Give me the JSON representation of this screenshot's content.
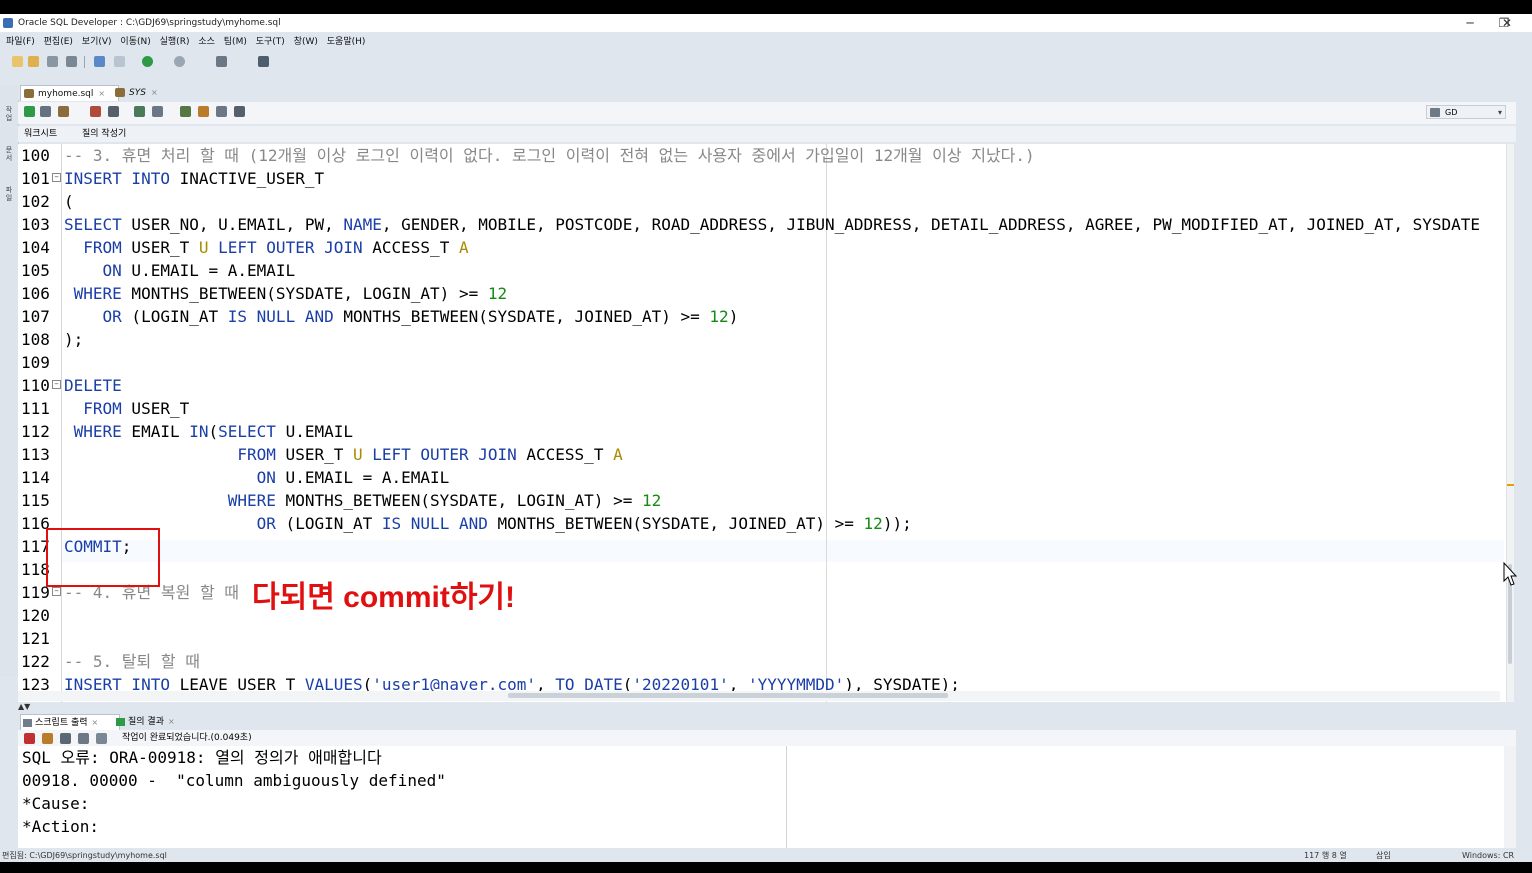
{
  "window": {
    "title": "Oracle SQL Developer : C:\\GDJ69\\springstudy\\myhome.sql"
  },
  "window_controls": {
    "minimize": "─",
    "restore": "❐",
    "close": "✕"
  },
  "menu": [
    "파일(F)",
    "편집(E)",
    "보기(V)",
    "이동(N)",
    "실행(R)",
    "소스",
    "팀(M)",
    "도구(T)",
    "창(W)",
    "도움말(H)"
  ],
  "tabs": [
    {
      "label": "myhome.sql",
      "active": true
    },
    {
      "label": "SYS",
      "active": false
    }
  ],
  "tab_close": "×",
  "connection": {
    "label": "GD",
    "dropdown": "▾"
  },
  "subtabs": {
    "worksheet": "워크시트",
    "query_builder": "질의 작성기"
  },
  "left_rail": [
    "작업",
    "문서",
    "파일"
  ],
  "editor_lines": [
    {
      "n": "100",
      "fold": "",
      "segs": [
        {
          "t": "-- 3. 휴면 처리 할 때 (12개월 이상 로그인 이력이 없다. 로그인 이력이 전혀 없는 사용자 중에서 가입일이 12개월 이상 지났다.)",
          "c": "cm"
        }
      ]
    },
    {
      "n": "101",
      "fold": "⊟",
      "segs": [
        {
          "t": "INSERT INTO",
          "c": "kw"
        },
        {
          "t": " INACTIVE_USER_T",
          "c": ""
        }
      ]
    },
    {
      "n": "102",
      "fold": "",
      "segs": [
        {
          "t": "(",
          "c": ""
        }
      ]
    },
    {
      "n": "103",
      "fold": "",
      "segs": [
        {
          "t": "SELECT",
          "c": "kw"
        },
        {
          "t": " USER_NO, U.EMAIL, PW, ",
          "c": ""
        },
        {
          "t": "NAME",
          "c": "kw"
        },
        {
          "t": ", GENDER, MOBILE, POSTCODE, ROAD_ADDRESS, JIBUN_ADDRESS, DETAIL_ADDRESS, AGREE, PW_MODIFIED_AT, JOINED_AT, SYSDATE",
          "c": ""
        }
      ]
    },
    {
      "n": "104",
      "fold": "",
      "segs": [
        {
          "t": "  FROM",
          "c": "kw"
        },
        {
          "t": " USER_T ",
          "c": ""
        },
        {
          "t": "U",
          "c": "al"
        },
        {
          "t": " LEFT OUTER JOIN",
          "c": "kw"
        },
        {
          "t": " ACCESS_T ",
          "c": ""
        },
        {
          "t": "A",
          "c": "al"
        }
      ]
    },
    {
      "n": "105",
      "fold": "",
      "segs": [
        {
          "t": "    ON",
          "c": "kw"
        },
        {
          "t": " U.EMAIL = A.EMAIL",
          "c": ""
        }
      ]
    },
    {
      "n": "106",
      "fold": "",
      "segs": [
        {
          "t": " WHERE",
          "c": "kw"
        },
        {
          "t": " MONTHS_BETWEEN(SYSDATE, LOGIN_AT) >= ",
          "c": ""
        },
        {
          "t": "12",
          "c": "num"
        }
      ]
    },
    {
      "n": "107",
      "fold": "",
      "segs": [
        {
          "t": "    OR",
          "c": "kw"
        },
        {
          "t": " (LOGIN_AT ",
          "c": ""
        },
        {
          "t": "IS NULL AND",
          "c": "kw"
        },
        {
          "t": " MONTHS_BETWEEN(SYSDATE, JOINED_AT) >= ",
          "c": ""
        },
        {
          "t": "12",
          "c": "num"
        },
        {
          "t": ")",
          "c": ""
        }
      ]
    },
    {
      "n": "108",
      "fold": "",
      "segs": [
        {
          "t": ");",
          "c": ""
        }
      ]
    },
    {
      "n": "109",
      "fold": "",
      "segs": []
    },
    {
      "n": "110",
      "fold": "⊟",
      "segs": [
        {
          "t": "DELETE",
          "c": "kw"
        }
      ]
    },
    {
      "n": "111",
      "fold": "",
      "segs": [
        {
          "t": "  FROM",
          "c": "kw"
        },
        {
          "t": " USER_T",
          "c": ""
        }
      ]
    },
    {
      "n": "112",
      "fold": "",
      "segs": [
        {
          "t": " WHERE",
          "c": "kw"
        },
        {
          "t": " EMAIL ",
          "c": ""
        },
        {
          "t": "IN",
          "c": "kw"
        },
        {
          "t": "(",
          "c": ""
        },
        {
          "t": "SELECT",
          "c": "kw"
        },
        {
          "t": " U.EMAIL",
          "c": ""
        }
      ]
    },
    {
      "n": "113",
      "fold": "",
      "segs": [
        {
          "t": "                  FROM",
          "c": "kw"
        },
        {
          "t": " USER_T ",
          "c": ""
        },
        {
          "t": "U",
          "c": "al"
        },
        {
          "t": " LEFT OUTER JOIN",
          "c": "kw"
        },
        {
          "t": " ACCESS_T ",
          "c": ""
        },
        {
          "t": "A",
          "c": "al"
        }
      ]
    },
    {
      "n": "114",
      "fold": "",
      "segs": [
        {
          "t": "                    ON",
          "c": "kw"
        },
        {
          "t": " U.EMAIL = A.EMAIL",
          "c": ""
        }
      ]
    },
    {
      "n": "115",
      "fold": "",
      "segs": [
        {
          "t": "                 WHERE",
          "c": "kw"
        },
        {
          "t": " MONTHS_BETWEEN(SYSDATE, LOGIN_AT) >= ",
          "c": ""
        },
        {
          "t": "12",
          "c": "num"
        }
      ]
    },
    {
      "n": "116",
      "fold": "",
      "segs": [
        {
          "t": "                    OR",
          "c": "kw"
        },
        {
          "t": " (LOGIN_AT ",
          "c": ""
        },
        {
          "t": "IS NULL AND",
          "c": "kw"
        },
        {
          "t": " MONTHS_BETWEEN(SYSDATE, JOINED_AT) >= ",
          "c": ""
        },
        {
          "t": "12",
          "c": "num"
        },
        {
          "t": "));",
          "c": ""
        }
      ]
    },
    {
      "n": "117",
      "fold": "",
      "segs": [
        {
          "t": "COMMIT",
          "c": "kw"
        },
        {
          "t": ";",
          "c": ""
        }
      ]
    },
    {
      "n": "118",
      "fold": "",
      "segs": []
    },
    {
      "n": "119",
      "fold": "⊟",
      "segs": [
        {
          "t": "-- 4. 휴면 복원 할 때",
          "c": "cm"
        }
      ]
    },
    {
      "n": "120",
      "fold": "",
      "segs": []
    },
    {
      "n": "121",
      "fold": "",
      "segs": []
    },
    {
      "n": "122",
      "fold": "",
      "segs": [
        {
          "t": "-- 5. 탈퇴 할 때",
          "c": "cm"
        }
      ]
    },
    {
      "n": "123",
      "fold": "",
      "segs": [
        {
          "t": "INSERT INTO",
          "c": "kw"
        },
        {
          "t": " LEAVE_USER_T ",
          "c": ""
        },
        {
          "t": "VALUES",
          "c": "kw"
        },
        {
          "t": "(",
          "c": ""
        },
        {
          "t": "'user1@naver.com'",
          "c": "st"
        },
        {
          "t": ", ",
          "c": ""
        },
        {
          "t": "TO_DATE",
          "c": "kw"
        },
        {
          "t": "(",
          "c": ""
        },
        {
          "t": "'20220101'",
          "c": "st"
        },
        {
          "t": ", ",
          "c": ""
        },
        {
          "t": "'YYYYMMDD'",
          "c": "st"
        },
        {
          "t": "), SYSDATE);",
          "c": ""
        }
      ]
    }
  ],
  "annotation": {
    "text": "다되면 commit하기!",
    "color": "#e01010"
  },
  "output_tabs": [
    {
      "label": "스크립트 출력",
      "active": true
    },
    {
      "label": "질의 결과",
      "active": false
    }
  ],
  "output_status": "작업이 완료되었습니다.(0.049초)",
  "output_lines": [
    "SQL 오류: ORA-00918: 열의 정의가 애매합니다",
    "00918. 00000 -  \"column ambiguously defined\"",
    "*Cause:",
    "*Action:"
  ],
  "statusbar": {
    "path": "편집됨: C:\\GDJ69\\springstudy\\myhome.sql",
    "position": "117 행 8 열",
    "mode": "삽입",
    "platform": "Windows: CR"
  },
  "colors": {
    "keyword": "#1a3ea8",
    "comment": "#888888",
    "number": "#138a13",
    "alias": "#a88b00",
    "annotation": "#e01010"
  }
}
